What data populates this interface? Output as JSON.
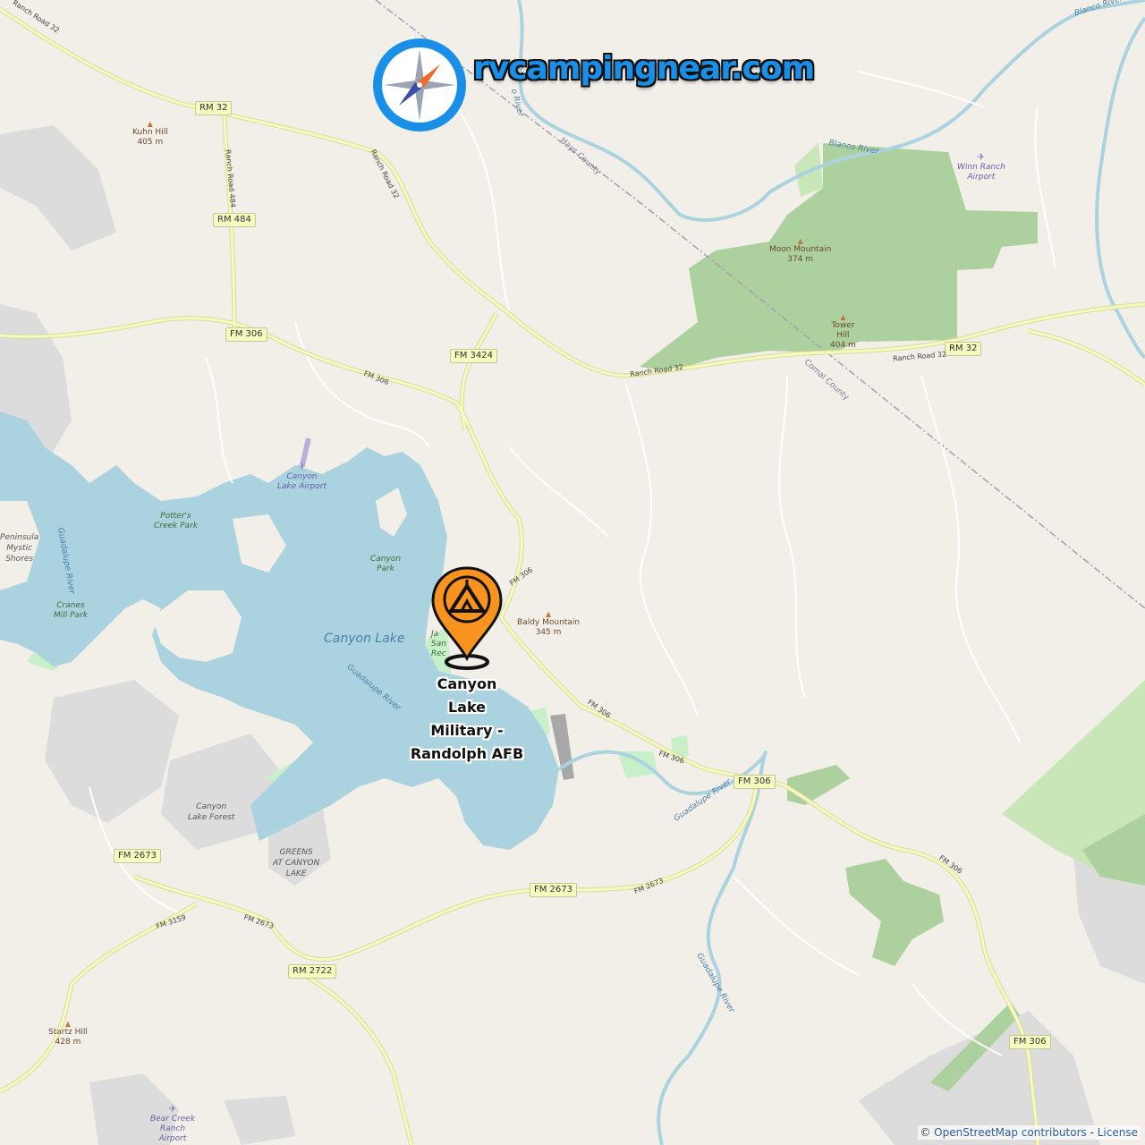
{
  "site": {
    "logo_text": "rvcampingnear.com"
  },
  "marker": {
    "lines": [
      "Canyon",
      "Lake",
      "Military -",
      "Randolph AFB"
    ],
    "icon": "tent-marker-icon",
    "accent": "#f7931e"
  },
  "attribution": {
    "copyright": "©",
    "contributors_link": "OpenStreetMap contributors",
    "separator": " - ",
    "license_link": "License"
  },
  "colors": {
    "land": "#f2efe9",
    "water": "#aad3df",
    "park": "#add19e",
    "road_major": "#f7fabf",
    "road_minor": "#ffffff",
    "urban": "#d9d9d9",
    "logo": "#1a8fe8"
  },
  "shields": {
    "rm32_nw": "RM 32",
    "rm484": "RM 484",
    "fm306_w": "FM 306",
    "fm3424": "FM 3424",
    "rm32_e": "RM 32",
    "fm306_se": "FM 306",
    "fm2673_w": "FM 2673",
    "fm2673_c": "FM 2673",
    "rm2722": "RM 2722",
    "fm306_s": "FM 306"
  },
  "road_labels": {
    "ranch32_nw": "Ranch Road 32",
    "ranch32_n": "Ranch Road 32",
    "ranch484": "Ranch Road 484",
    "fm306_a": "FM 306",
    "ranch32_c": "Ranch Road 32",
    "ranch32_e": "Ranch Road 32",
    "fm306_b": "FM 306",
    "fm306_c": "FM 306",
    "fm306_d": "FM 306",
    "fm306_e": "FM 306",
    "fm2673_a": "FM 2673",
    "fm2673_b": "FM 2673",
    "fm3159": "FM 3159"
  },
  "places": {
    "kuhn_hill": [
      "Kuhn Hill",
      "405 m"
    ],
    "moon_mountain": [
      "Moon Mountain",
      "374 m"
    ],
    "tower_hill": [
      "Tower",
      "Hill",
      "404 m"
    ],
    "baldy_mountain": [
      "Baldy Mountain",
      "345 m"
    ],
    "startz_hill": [
      "Startz Hill",
      "428 m"
    ],
    "peninsula": [
      "Peninsula",
      "Mystic",
      "Shores"
    ],
    "canyon_lake_forest": [
      "Canyon",
      "Lake Forest"
    ],
    "greens": [
      "GREENS",
      "AT CANYON",
      "LAKE"
    ]
  },
  "parks": {
    "potters": [
      "Potter's",
      "Creek Park"
    ],
    "canyon_park": [
      "Canyon",
      "Park"
    ],
    "cranes": [
      "Cranes",
      "Mill Park"
    ],
    "jacobs": [
      "Ja",
      "San",
      "Rec"
    ]
  },
  "airports": {
    "canyon_lake": [
      "Canyon",
      "Lake Airport"
    ],
    "winn_ranch": [
      "Winn Ranch",
      "Airport"
    ],
    "bear_creek": [
      "Bear Creek",
      "Ranch",
      "Airport"
    ]
  },
  "water": {
    "lake": "Canyon Lake",
    "guadalupe_1": "Guadalupe River",
    "guadalupe_2": "Guadalupe River",
    "guadalupe_3": "Guadalupe River",
    "guadalupe_4": "Guadalupe River",
    "blanco_1": "Blanco River",
    "blanco_2": "Blanco River",
    "river_n": "o River"
  },
  "boundaries": {
    "hays": "Hays County",
    "comal": "Comal County"
  }
}
